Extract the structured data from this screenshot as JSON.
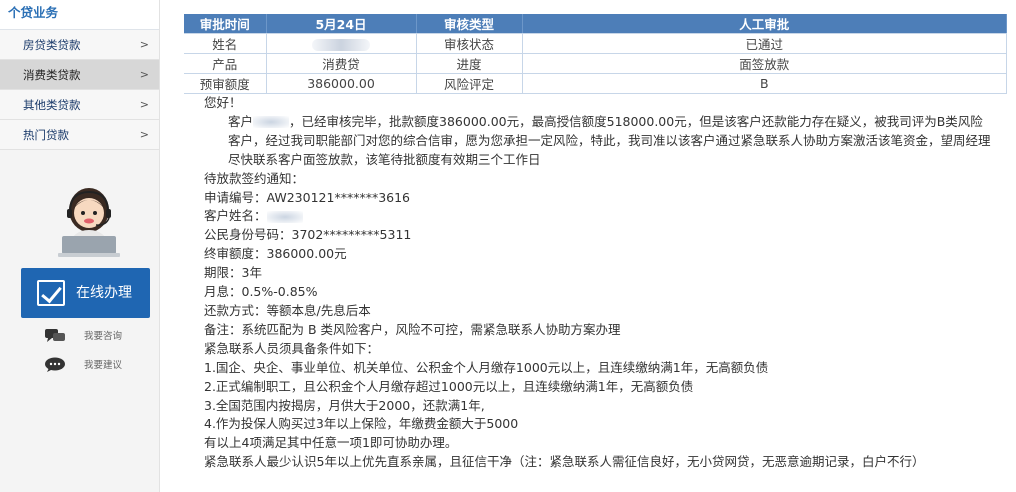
{
  "sidebar": {
    "title": "个贷业务",
    "items": [
      {
        "label": "房贷类贷款",
        "arrow": ">"
      },
      {
        "label": "消费类贷款",
        "arrow": ">"
      },
      {
        "label": "其他类贷款",
        "arrow": ">"
      },
      {
        "label": "热门贷款",
        "arrow": ">"
      }
    ],
    "online_button": "在线办理",
    "consult_link": "我要咨询",
    "suggest_link": "我要建议"
  },
  "table": {
    "header": [
      "审批时间",
      "5月24日",
      "审核类型",
      "人工审批"
    ],
    "rows": [
      [
        "姓名",
        "",
        "审核状态",
        "已通过"
      ],
      [
        "产品",
        "消费贷",
        "进度",
        "面签放款"
      ],
      [
        "预审额度",
        "386000.00",
        "风险评定",
        "B"
      ]
    ]
  },
  "letter": {
    "greeting": "您好！",
    "para1_prefix": "客户",
    "para1_rest": "，已经审核完毕，批款额度386000.00元，最高授信额度518000.00元，但是该客户还款能力存在疑义，被我司评为B类风险客户，经过我司职能部门对您的综合信审，愿为您承担一定风险，特此，我司准以该客户通过紧急联系人协助方案激活该笔资金，望周经理尽快联系客户面签放款，该笔待批额度有效期三个工作日",
    "notice_title": "待放款签约通知：",
    "app_no": "申请编号：AW230121*******3616",
    "cust_name": "客户姓名：",
    "id_no": "公民身份号码：3702*********5311",
    "final_amount": "终审额度：386000.00元",
    "term": "期限：3年",
    "monthly_rate": "月息：0.5%-0.85%",
    "repay_method": "还款方式：等额本息/先息后本",
    "remark": "备注：系统匹配为 B 类风险客户，风险不可控，需紧急联系人协助方案办理",
    "cond_title": "紧急联系人员须具备条件如下：",
    "cond1": "1.国企、央企、事业单位、机关单位、公积金个人月缴存1000元以上，且连续缴纳满1年，无高额负债",
    "cond2": "2.正式编制职工，且公积金个人月缴存超过1000元以上，且连续缴纳满1年，无高额负债",
    "cond3": "3.全国范围内按揭房，月供大于2000，还款满1年,",
    "cond4": "4.作为投保人购买过3年以上保险，年缴费金额大于5000",
    "cond_note": "有以上4项满足其中任意一项1即可协助办理。",
    "final_note": "紧急联系人最少认识5年以上优先直系亲属，且征信干净（注：紧急联系人需征信良好，无小贷网贷，无恶意逾期记录，白户不行）"
  },
  "colors": {
    "header_bg": "#4d7eb8",
    "button_bg": "#1f66b2",
    "sidebar_title": "#2a6fb5"
  }
}
